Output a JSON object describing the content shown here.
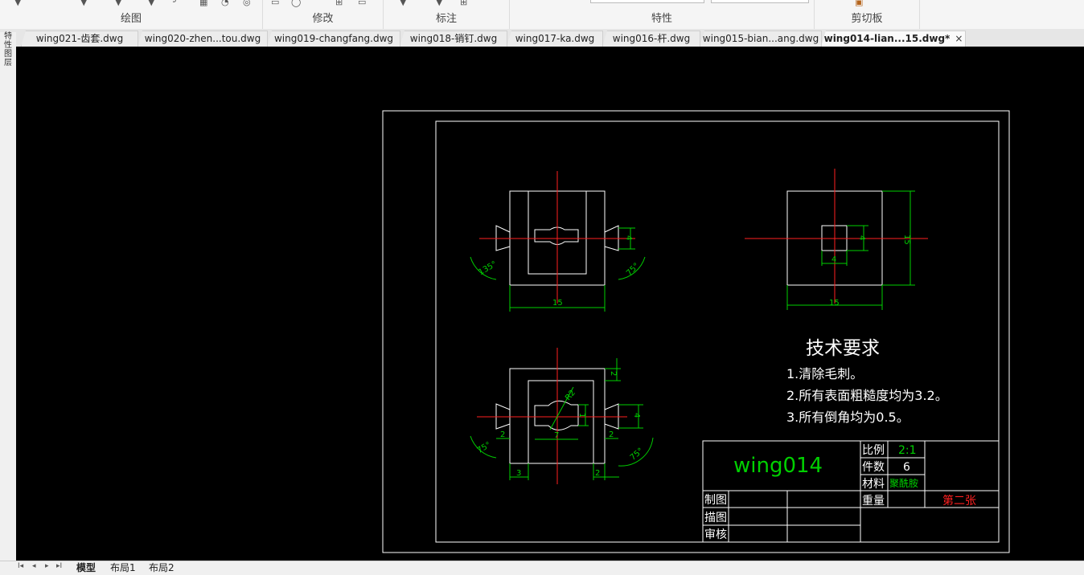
{
  "ribbon": {
    "groups": [
      "绘图",
      "修改",
      "标注",
      "特性",
      "剪切板"
    ]
  },
  "tabs": [
    {
      "label": "wing021-齿套.dwg"
    },
    {
      "label": "wing020-zhen...tou.dwg"
    },
    {
      "label": "wing019-changfang.dwg"
    },
    {
      "label": "wing018-销钉.dwg"
    },
    {
      "label": "wing017-ka.dwg"
    },
    {
      "label": "wing016-杆.dwg"
    },
    {
      "label": "wing015-bian...ang.dwg"
    },
    {
      "label": "wing014-lian...15.dwg*",
      "active": true,
      "close": "×"
    }
  ],
  "drawing": {
    "dims": {
      "d15a": "15",
      "d4a": "4",
      "ang1": "135°",
      "ang2": "75°",
      "d15b": "15",
      "d15c": "15",
      "d4b": "4",
      "d4c": "4",
      "r22": "R2",
      "d2top": "2",
      "d1": "1",
      "d7": "7",
      "d2l": "2",
      "d2r": "2",
      "d4d": "4",
      "d3": "3",
      "d2b": "2",
      "ang3": "75°",
      "ang4": "75°"
    },
    "tech": {
      "title": "技术要求",
      "line1": "1.清除毛刺。",
      "line2": "2.所有表面粗糙度均为3.2。",
      "line3": "3.所有倒角均为0.5。"
    },
    "title_block": {
      "name": "wing014",
      "scale_label": "比例",
      "scale": "2:1",
      "count_label": "件数",
      "count": "6",
      "material_label": "材料",
      "material": "聚酰胺",
      "weight_label": "重量",
      "sheet": "第二张",
      "drawn": "制图",
      "traced": "描图",
      "checked": "审核"
    }
  },
  "status": {
    "nav": [
      "I◂",
      "◂",
      "▸",
      "▸I"
    ],
    "layout_tabs": [
      "模型",
      "布局1",
      "布局2"
    ]
  },
  "left_toolbar": [
    "特",
    "性",
    "图",
    "层"
  ]
}
